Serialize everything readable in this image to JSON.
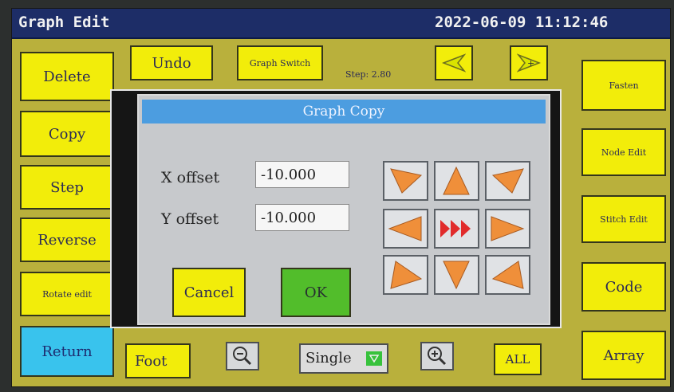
{
  "title": "Graph Edit",
  "datetime": "2022-06-09 11:12:46",
  "top": {
    "undo": "Undo",
    "graph_switch": "Graph Switch",
    "step": "Step: 2.80"
  },
  "left": {
    "delete": "Delete",
    "copy": "Copy",
    "step": "Step",
    "reverse": "Reverse",
    "rotate_edit": "Rotate edit",
    "return": "Return"
  },
  "right": {
    "fasten": "Fasten",
    "node_edit": "Node Edit",
    "stitch_edit": "Stitch Edit",
    "code": "Code",
    "array": "Array"
  },
  "bottom": {
    "foot": "Foot",
    "mode": "Single",
    "all": "ALL"
  },
  "dialog": {
    "title": "Graph Copy",
    "x_label": "X offset",
    "x_value": "-10.000",
    "y_label": "Y offset",
    "y_value": "-10.000",
    "cancel": "Cancel",
    "ok": "OK"
  },
  "colors": {
    "panel": "#b9b03c",
    "titlebar": "#1d2d67",
    "button_yellow": "#f2ed0a",
    "button_blue": "#39c3ed",
    "ok_green": "#52bd2b",
    "arrow_orange": "#ef8f3a",
    "center_red": "#e12b2b"
  },
  "icons": [
    "arrow-left-icon",
    "arrow-right-icon",
    "zoom-out-icon",
    "zoom-in-icon",
    "dropdown-icon",
    "direction-pad"
  ]
}
